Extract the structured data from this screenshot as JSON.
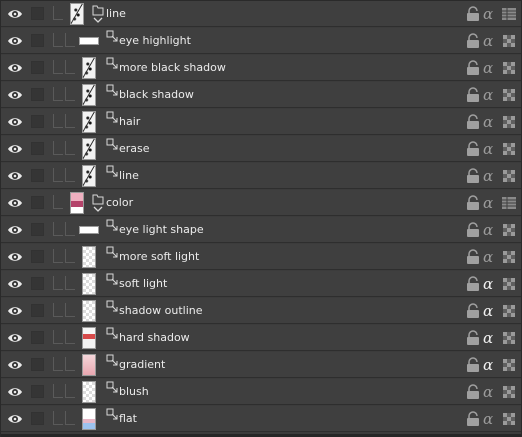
{
  "panel": {
    "title": ""
  },
  "layers": [
    {
      "name": "line",
      "type": "folder",
      "thumb": "sketch",
      "alpha": "off",
      "mode": "grid",
      "clipped": false
    },
    {
      "name": "eye highlight",
      "type": "layer",
      "thumb": "wide",
      "alpha": "off",
      "mode": "checker",
      "clipped": true
    },
    {
      "name": "more black shadow",
      "type": "layer",
      "thumb": "sketch",
      "alpha": "off",
      "mode": "checker",
      "clipped": true
    },
    {
      "name": "black shadow",
      "type": "layer",
      "thumb": "sketch",
      "alpha": "off",
      "mode": "checker",
      "clipped": true
    },
    {
      "name": "hair",
      "type": "layer",
      "thumb": "sketch",
      "alpha": "off",
      "mode": "checker",
      "clipped": true
    },
    {
      "name": "erase",
      "type": "layer",
      "thumb": "sketch",
      "alpha": "off",
      "mode": "checker",
      "clipped": true
    },
    {
      "name": "line",
      "type": "layer",
      "thumb": "sketch",
      "alpha": "off",
      "mode": "checker",
      "clipped": true
    },
    {
      "name": "color",
      "type": "folder",
      "thumb": "color",
      "alpha": "off",
      "mode": "grid",
      "clipped": false
    },
    {
      "name": "eye light shape",
      "type": "layer",
      "thumb": "wide",
      "alpha": "off",
      "mode": "checker",
      "clipped": true
    },
    {
      "name": "more soft light",
      "type": "layer",
      "thumb": "checker",
      "alpha": "off",
      "mode": "checker",
      "clipped": true
    },
    {
      "name": "soft light",
      "type": "layer",
      "thumb": "checker",
      "alpha": "on",
      "mode": "checker",
      "clipped": true
    },
    {
      "name": "shadow outline",
      "type": "layer",
      "thumb": "checker",
      "alpha": "on",
      "mode": "checker",
      "clipped": true
    },
    {
      "name": "hard shadow",
      "type": "layer",
      "thumb": "redish",
      "alpha": "on",
      "mode": "checker",
      "clipped": true
    },
    {
      "name": "gradient",
      "type": "layer",
      "thumb": "pinkish",
      "alpha": "on",
      "mode": "checker",
      "clipped": true
    },
    {
      "name": "blush",
      "type": "layer",
      "thumb": "checker",
      "alpha": "off",
      "mode": "checker",
      "clipped": true
    },
    {
      "name": "flat",
      "type": "layer",
      "thumb": "flat",
      "alpha": "off",
      "mode": "checker",
      "clipped": false
    }
  ],
  "icons": {
    "visibility": "eye-icon",
    "lock": "lock-icon",
    "alpha": "alpha-lock-icon",
    "folder": "folder-icon",
    "clip": "clipping-icon"
  },
  "colors": {
    "panel_bg": "#3c3c3c",
    "row_bg": "#3f3f3f",
    "text": "#ececec"
  }
}
